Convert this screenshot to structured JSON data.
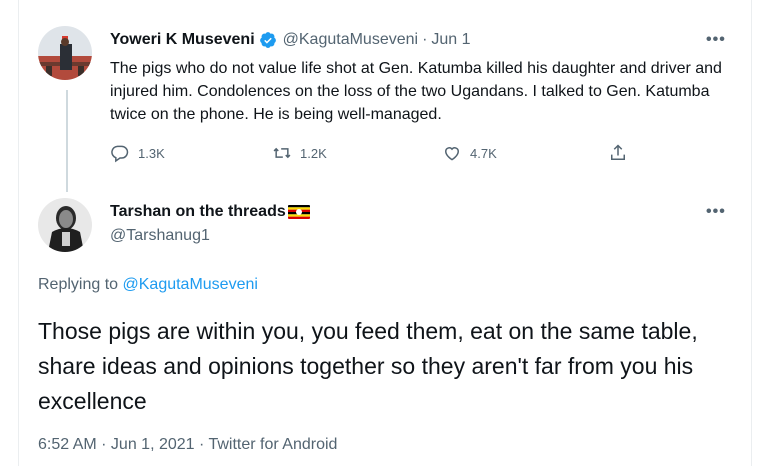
{
  "tweet1": {
    "author_name": "Yoweri K Museveni",
    "verified_icon": "verified-badge-icon",
    "handle": "@KagutaMuseveni",
    "separator": "·",
    "date": "Jun 1",
    "more": "•••",
    "text": "The pigs who do not value life shot at Gen. Katumba killed his daughter and driver and injured him.  Condolences on the loss of the two Ugandans.  I talked to Gen. Katumba twice on the phone. He is being well-managed.",
    "actions": {
      "reply_count": "1.3K",
      "retweet_count": "1.2K",
      "like_count": "4.7K"
    }
  },
  "tweet2": {
    "author_name": "Tarshan on the threads",
    "flag_icon": "uganda-flag-icon",
    "handle": "@Tarshanug1",
    "more": "•••",
    "replying_prefix": "Replying to ",
    "replying_to": "@KagutaMuseveni",
    "text": "Those pigs are within you, you feed them, eat on the same table, share ideas and opinions together so they aren't far from you his excellence",
    "meta": "6:52 AM · Jun 1, 2021 · Twitter for Android"
  },
  "colors": {
    "text_primary": "#0f1419",
    "text_secondary": "#536471",
    "link": "#1d9bf0",
    "verified": "#1d9bf0",
    "thread_line": "#cfd9de"
  }
}
